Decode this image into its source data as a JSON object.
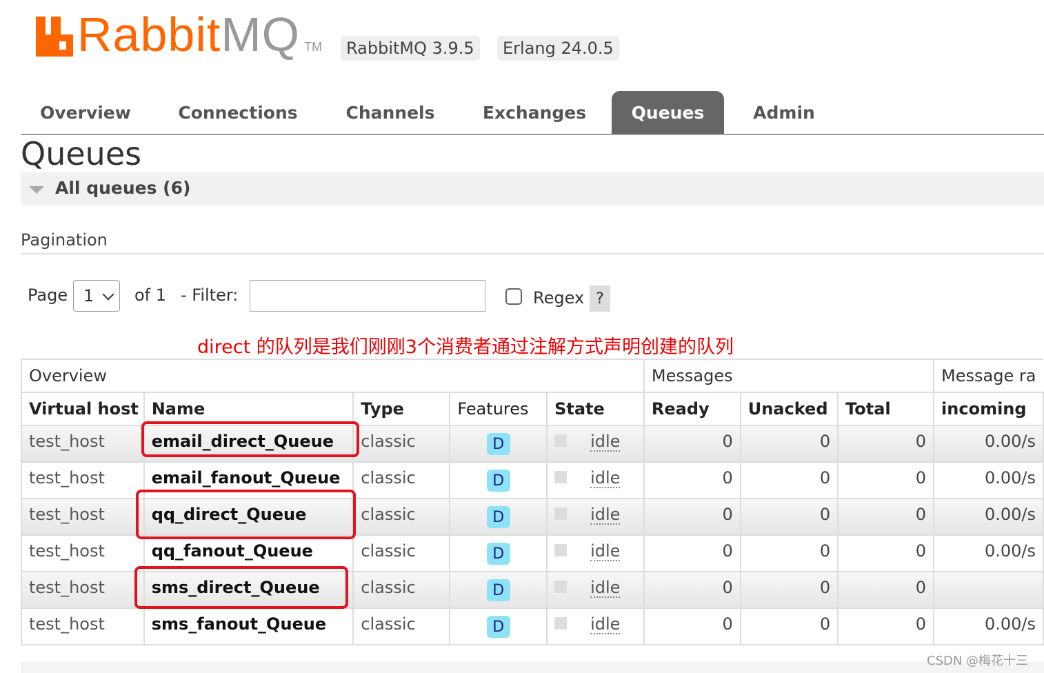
{
  "header": {
    "logo_rabbit": "Rabbit",
    "logo_mq": "MQ",
    "logo_tm": "TM",
    "version_badge": "RabbitMQ 3.9.5",
    "erlang_badge": "Erlang 24.0.5"
  },
  "tabs": [
    {
      "label": "Overview"
    },
    {
      "label": "Connections"
    },
    {
      "label": "Channels"
    },
    {
      "label": "Exchanges"
    },
    {
      "label": "Queues"
    },
    {
      "label": "Admin"
    }
  ],
  "page_title": "Queues",
  "section_label": "All queues (6)",
  "pagination": {
    "title": "Pagination",
    "page_label": "Page",
    "page_value": "1",
    "of_label": "of 1",
    "filter_label": "- Filter:",
    "filter_value": "",
    "regex_label": "Regex",
    "help_label": "?"
  },
  "annotation": "direct 的队列是我们刚刚3个消费者通过注解方式声明创建的队列",
  "table": {
    "groups": [
      "Overview",
      "Messages",
      "Message ra"
    ],
    "columns": [
      "Virtual host",
      "Name",
      "Type",
      "Features",
      "State",
      "Ready",
      "Unacked",
      "Total",
      "incoming"
    ],
    "rows": [
      {
        "vhost": "test_host",
        "name": "email_direct_Queue",
        "type": "classic",
        "feature": "D",
        "state": "idle",
        "ready": "0",
        "unacked": "0",
        "total": "0",
        "incoming": "0.00/s"
      },
      {
        "vhost": "test_host",
        "name": "email_fanout_Queue",
        "type": "classic",
        "feature": "D",
        "state": "idle",
        "ready": "0",
        "unacked": "0",
        "total": "0",
        "incoming": "0.00/s"
      },
      {
        "vhost": "test_host",
        "name": "qq_direct_Queue",
        "type": "classic",
        "feature": "D",
        "state": "idle",
        "ready": "0",
        "unacked": "0",
        "total": "0",
        "incoming": "0.00/s"
      },
      {
        "vhost": "test_host",
        "name": "qq_fanout_Queue",
        "type": "classic",
        "feature": "D",
        "state": "idle",
        "ready": "0",
        "unacked": "0",
        "total": "0",
        "incoming": "0.00/s"
      },
      {
        "vhost": "test_host",
        "name": "sms_direct_Queue",
        "type": "classic",
        "feature": "D",
        "state": "idle",
        "ready": "0",
        "unacked": "0",
        "total": "0",
        "incoming": ""
      },
      {
        "vhost": "test_host",
        "name": "sms_fanout_Queue",
        "type": "classic",
        "feature": "D",
        "state": "idle",
        "ready": "0",
        "unacked": "0",
        "total": "0",
        "incoming": "0.00/s"
      }
    ]
  },
  "watermark": "CSDN @梅花十三",
  "colors": {
    "brand_orange": "#ff6600",
    "active_tab": "#666666",
    "annotation_red": "#e2121e",
    "feature_badge": "#8de2f5"
  }
}
